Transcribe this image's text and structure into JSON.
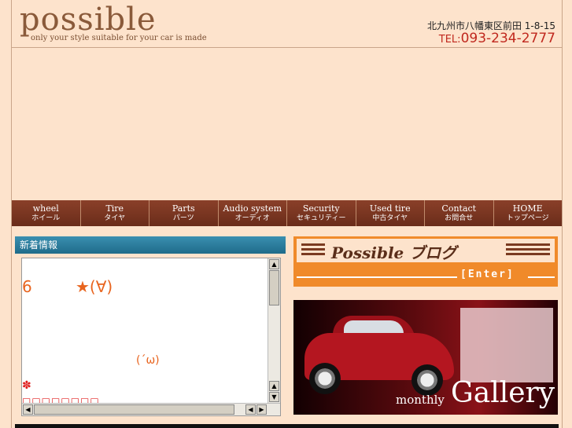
{
  "header": {
    "logo": "possible",
    "tagline": "only your style suitable for your car is made",
    "address": "北九州市八幡東区前田 1-8-15",
    "tel_label": "TEL:",
    "tel_number": "093-234-2777"
  },
  "nav": [
    {
      "en": "wheel",
      "jp": "ホイール"
    },
    {
      "en": "Tire",
      "jp": "タイヤ"
    },
    {
      "en": "Parts",
      "jp": "パーツ"
    },
    {
      "en": "Audio system",
      "jp": "オーディオ"
    },
    {
      "en": "Security",
      "jp": "セキュリティー"
    },
    {
      "en": "Used tire",
      "jp": "中古タイヤ"
    },
    {
      "en": "Contact",
      "jp": "お問合せ"
    },
    {
      "en": "HOME",
      "jp": "トップページ"
    }
  ],
  "news": {
    "heading": "新着情報",
    "line1_num": "6",
    "line1_face": "★(∀)",
    "line2": "(´ω)",
    "line3": "✽",
    "line4": "□□□□□□□□"
  },
  "blog": {
    "title": "Possible ブログ",
    "enter": "[Enter]"
  },
  "gallery": {
    "monthly": "monthly",
    "title": "Gallery"
  }
}
